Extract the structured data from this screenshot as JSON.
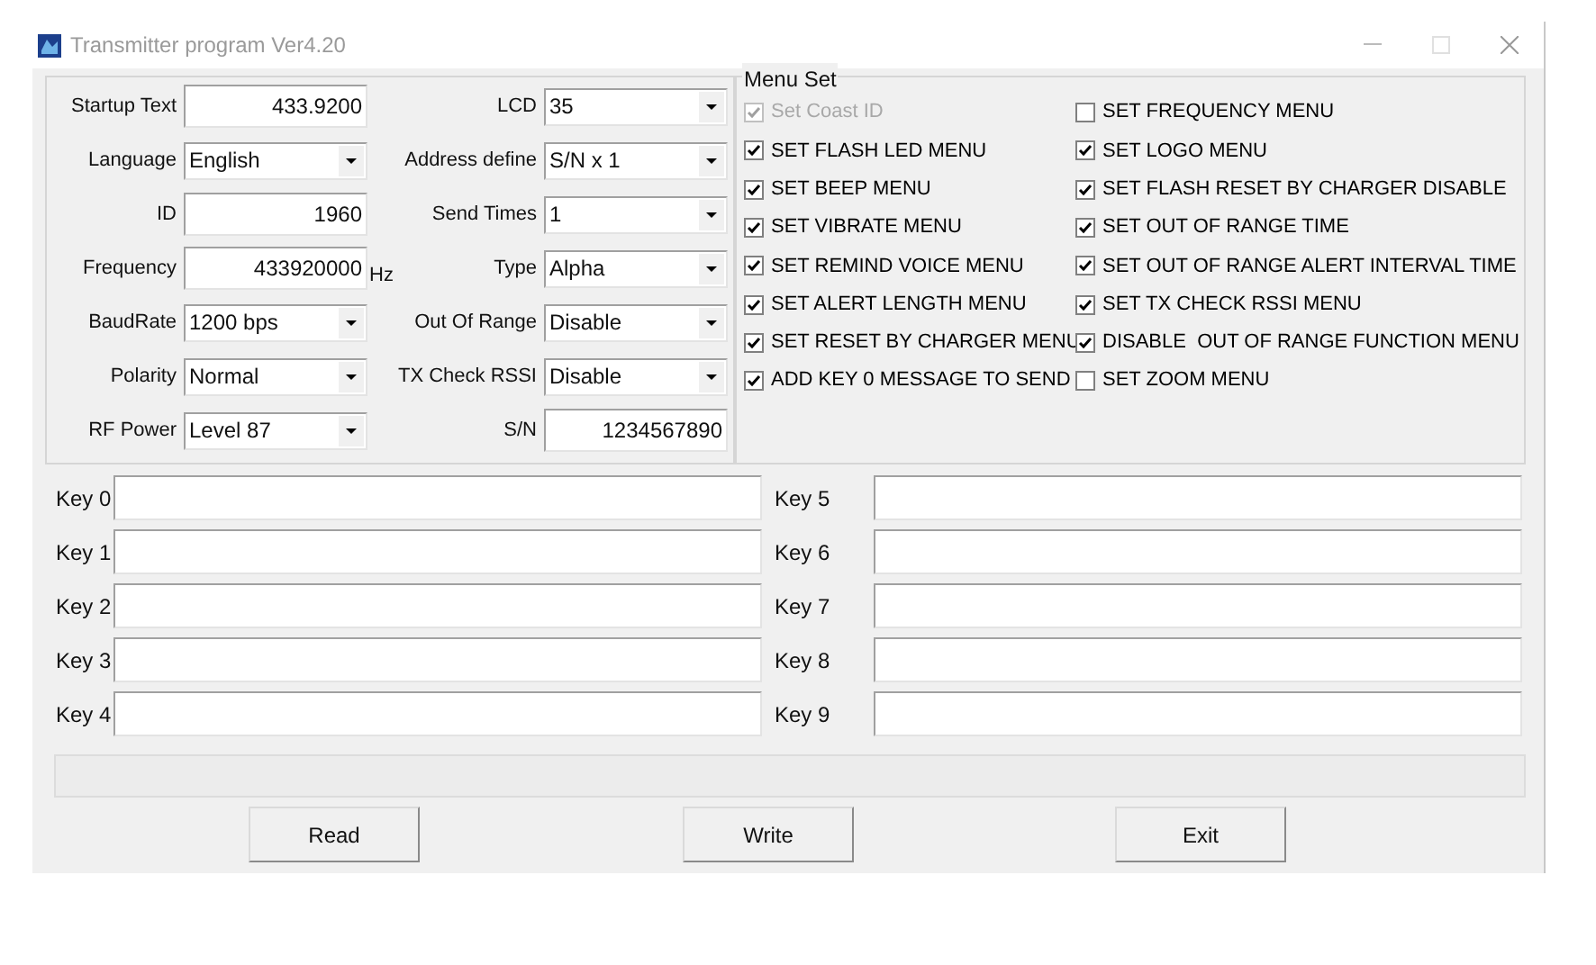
{
  "window": {
    "title": "Transmitter program Ver4.20"
  },
  "settings_left": [
    {
      "label": "Startup Text",
      "kind": "text",
      "value": "433.9200"
    },
    {
      "label": "Language",
      "kind": "select",
      "value": "English"
    },
    {
      "label": "ID",
      "kind": "text",
      "value": "1960"
    },
    {
      "label": "Frequency",
      "kind": "text",
      "value": "433920000",
      "unit": "Hz"
    },
    {
      "label": "BaudRate",
      "kind": "select",
      "value": "1200 bps"
    },
    {
      "label": "Polarity",
      "kind": "select",
      "value": "Normal"
    },
    {
      "label": "RF Power",
      "kind": "select",
      "value": "Level 87"
    }
  ],
  "settings_right": [
    {
      "label": "LCD",
      "kind": "select",
      "value": "35"
    },
    {
      "label": "Address define",
      "kind": "select",
      "value": "S/N x 1"
    },
    {
      "label": "Send Times",
      "kind": "select",
      "value": "1"
    },
    {
      "label": "Type",
      "kind": "select",
      "value": "Alpha"
    },
    {
      "label": "Out Of Range",
      "kind": "select",
      "value": "Disable"
    },
    {
      "label": "TX Check RSSI",
      "kind": "select",
      "value": "Disable"
    },
    {
      "label": "S/N",
      "kind": "text",
      "value": "1234567890"
    }
  ],
  "menu_set": {
    "title": "Menu Set",
    "columns": [
      [
        {
          "label": "Set Coast ID",
          "checked": true,
          "disabled": true
        },
        {
          "label": "SET FLASH LED MENU",
          "checked": true,
          "disabled": false
        },
        {
          "label": "SET BEEP MENU",
          "checked": true,
          "disabled": false
        },
        {
          "label": "SET VIBRATE MENU",
          "checked": true,
          "disabled": false
        },
        {
          "label": "SET REMIND VOICE MENU",
          "checked": true,
          "disabled": false
        },
        {
          "label": "SET ALERT LENGTH MENU",
          "checked": true,
          "disabled": false
        },
        {
          "label": "SET RESET BY CHARGER MENU",
          "checked": true,
          "disabled": false
        },
        {
          "label": "ADD KEY 0 MESSAGE TO SEND",
          "checked": true,
          "disabled": false
        }
      ],
      [
        {
          "label": "SET FREQUENCY MENU",
          "checked": false,
          "disabled": false
        },
        {
          "label": "SET LOGO MENU",
          "checked": true,
          "disabled": false
        },
        {
          "label": "SET FLASH RESET BY CHARGER DISABLE",
          "checked": true,
          "disabled": false
        },
        {
          "label": "SET OUT OF RANGE TIME",
          "checked": true,
          "disabled": false
        },
        {
          "label": "SET OUT OF RANGE ALERT INTERVAL TIME",
          "checked": true,
          "disabled": false
        },
        {
          "label": "SET TX CHECK RSSI MENU",
          "checked": true,
          "disabled": false
        },
        {
          "label": "DISABLE  OUT OF RANGE FUNCTION MENU",
          "checked": true,
          "disabled": false
        },
        {
          "label": "SET ZOOM MENU",
          "checked": false,
          "disabled": false
        }
      ]
    ]
  },
  "keys": [
    [
      {
        "label": "Key 0"
      },
      {
        "label": "Key 1"
      },
      {
        "label": "Key 2"
      },
      {
        "label": "Key 3"
      },
      {
        "label": "Key 4"
      }
    ],
    [
      {
        "label": "Key 5"
      },
      {
        "label": "Key 6"
      },
      {
        "label": "Key 7"
      },
      {
        "label": "Key 8"
      },
      {
        "label": "Key 9"
      }
    ]
  ],
  "buttons": [
    "Read",
    "Write",
    "Exit"
  ]
}
